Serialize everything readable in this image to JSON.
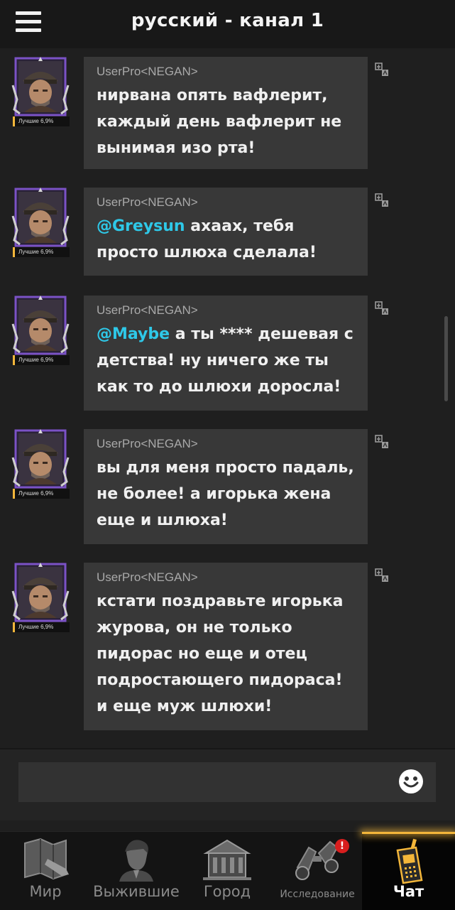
{
  "header": {
    "title": "русский - канал 1",
    "menu_icon": "hamburger-menu-icon"
  },
  "messages": [
    {
      "username": "UserPro<NEGAN>",
      "rank": "Лучшие 6,9%",
      "mention": "",
      "text": "нирвана опять вафлерит, каждый день вафлерит не вынимая изо рта!"
    },
    {
      "username": "UserPro<NEGAN>",
      "rank": "Лучшие 6,9%",
      "mention": "@Greysun",
      "text": " ахаах, тебя просто шлюха сделала!"
    },
    {
      "username": "UserPro<NEGAN>",
      "rank": "Лучшие 6,9%",
      "mention": "@Maybe",
      "text": " а ты **** дешевая с детства! ну ничего же ты как то до шлюхи доросла!"
    },
    {
      "username": "UserPro<NEGAN>",
      "rank": "Лучшие 6,9%",
      "mention": "",
      "text": "вы для меня просто падаль, не более! а игорька жена еще и шлюха!"
    },
    {
      "username": "UserPro<NEGAN>",
      "rank": "Лучшие 6,9%",
      "mention": "",
      "text": "кстати поздравьте игорька журова, он не только пидорас но еще и отец подростающего пидораса! и еще муж шлюхи!"
    }
  ],
  "input": {
    "value": "",
    "placeholder": ""
  },
  "nav": {
    "tabs": [
      {
        "label": "Мир",
        "icon": "world-map-icon",
        "active": false
      },
      {
        "label": "Выжившие",
        "icon": "survivor-portrait-icon",
        "active": false
      },
      {
        "label": "Город",
        "icon": "city-building-icon",
        "active": false
      },
      {
        "label": "Исследование",
        "icon": "binoculars-icon",
        "active": false,
        "badge": "!"
      },
      {
        "label": "Чат",
        "icon": "walkie-talkie-icon",
        "active": true
      }
    ]
  },
  "colors": {
    "bubble": "#383838",
    "mention": "#2ec8e8",
    "active_tab_glow": "#f3b63a",
    "badge": "#d81e1e",
    "avatar_frame": "#7b52c6"
  }
}
